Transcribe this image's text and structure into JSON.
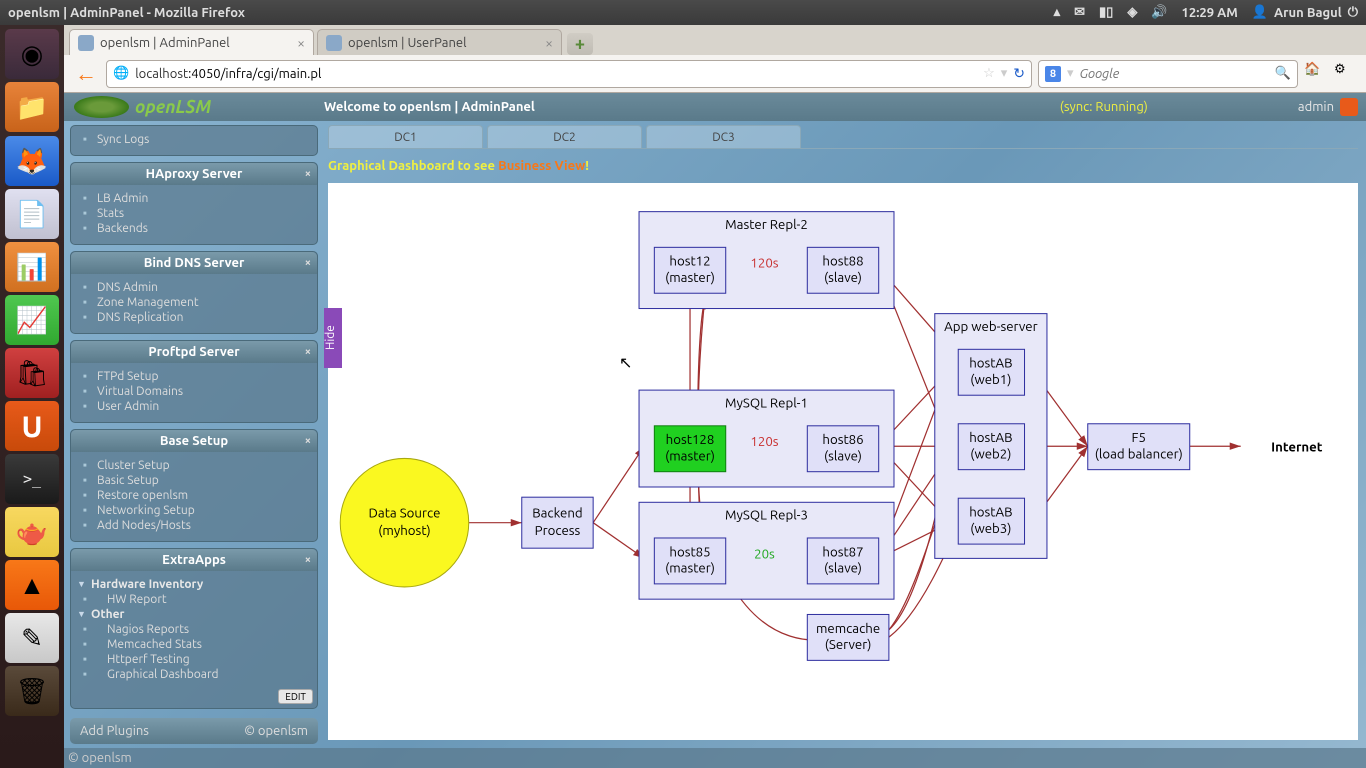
{
  "topbar": {
    "title": "openlsm | AdminPanel - Mozilla Firefox",
    "time": "12:29 AM",
    "user": "Arun Bagul"
  },
  "tabs": [
    {
      "title": "openlsm | AdminPanel",
      "active": true
    },
    {
      "title": "openlsm | UserPanel",
      "active": false
    }
  ],
  "url": {
    "host": "localhost",
    "rest": ":4050/infra/cgi/main.pl"
  },
  "search": {
    "placeholder": "Google"
  },
  "header": {
    "welcome": "Welcome to openlsm | AdminPanel",
    "sync": "(sync: Running)",
    "user": "admin"
  },
  "logo": "openLSM",
  "sidebar": {
    "synclogs": "Sync Logs",
    "panels": [
      {
        "title": "HAproxy Server",
        "items": [
          "LB Admin",
          "Stats",
          "Backends"
        ]
      },
      {
        "title": "Bind DNS Server",
        "items": [
          "DNS Admin",
          "Zone Management",
          "DNS Replication"
        ]
      },
      {
        "title": "Proftpd Server",
        "items": [
          "FTPd Setup",
          "Virtual Domains",
          "User Admin"
        ]
      },
      {
        "title": "Base Setup",
        "items": [
          "Cluster Setup",
          "Basic Setup",
          "Restore openlsm",
          "Networking Setup",
          "Add Nodes/Hosts"
        ]
      }
    ],
    "extra": {
      "title": "ExtraApps",
      "groups": [
        {
          "name": "Hardware Inventory",
          "items": [
            "HW Report"
          ]
        },
        {
          "name": "Other",
          "items": [
            "Nagios Reports",
            "Memcached Stats",
            "Httperf Testing",
            "Graphical Dashboard"
          ]
        }
      ],
      "edit": "EDIT"
    },
    "footer": {
      "add": "Add Plugins",
      "copy": "© openlsm"
    }
  },
  "dcTabs": [
    "DC1",
    "DC2",
    "DC3"
  ],
  "dashmsg": {
    "a": "Graphical Dashboard to see ",
    "b": "Business View",
    "c": "!"
  },
  "diagram": {
    "datasource": {
      "l1": "Data Source",
      "l2": "(myhost)"
    },
    "backend": {
      "l1": "Backend",
      "l2": "Process"
    },
    "repl2": {
      "title": "Master Repl-2",
      "master": {
        "l1": "host12",
        "l2": "(master)"
      },
      "slave": {
        "l1": "host88",
        "l2": "(slave)"
      },
      "delay": "120s"
    },
    "repl1": {
      "title": "MySQL Repl-1",
      "master": {
        "l1": "host128",
        "l2": "(master)"
      },
      "slave": {
        "l1": "host86",
        "l2": "(slave)"
      },
      "delay": "120s"
    },
    "repl3": {
      "title": "MySQL Repl-3",
      "master": {
        "l1": "host85",
        "l2": "(master)"
      },
      "slave": {
        "l1": "host87",
        "l2": "(slave)"
      },
      "delay": "20s"
    },
    "appws": {
      "title": "App web-server",
      "web1": {
        "l1": "hostAB",
        "l2": "(web1)"
      },
      "web2": {
        "l1": "hostAB",
        "l2": "(web2)"
      },
      "web3": {
        "l1": "hostAB",
        "l2": "(web3)"
      }
    },
    "memcache": {
      "l1": "memcache",
      "l2": "(Server)"
    },
    "f5": {
      "l1": "F5",
      "l2": "(load balancer)"
    },
    "internet": "Internet"
  },
  "footer": "© openlsm",
  "hide": "Hide"
}
